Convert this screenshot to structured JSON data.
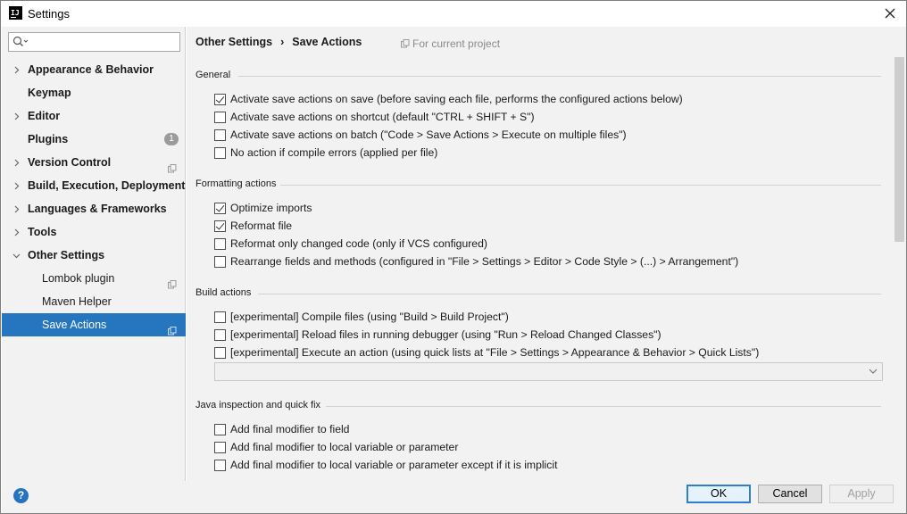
{
  "window": {
    "title": "Settings",
    "app_icon_text": "IJ"
  },
  "sidebar": {
    "search": {
      "value": "",
      "placeholder": ""
    },
    "items": [
      {
        "label": "Appearance & Behavior",
        "arrow": "right",
        "child": false
      },
      {
        "label": "Keymap",
        "arrow": "none",
        "child": false
      },
      {
        "label": "Editor",
        "arrow": "right",
        "child": false
      },
      {
        "label": "Plugins",
        "arrow": "none",
        "child": false,
        "badge": "1"
      },
      {
        "label": "Version Control",
        "arrow": "right",
        "child": false,
        "project_icon": true
      },
      {
        "label": "Build, Execution, Deployment",
        "arrow": "right",
        "child": false
      },
      {
        "label": "Languages & Frameworks",
        "arrow": "right",
        "child": false
      },
      {
        "label": "Tools",
        "arrow": "right",
        "child": false
      },
      {
        "label": "Other Settings",
        "arrow": "down",
        "child": false
      },
      {
        "label": "Lombok plugin",
        "arrow": "none",
        "child": true,
        "project_icon": true
      },
      {
        "label": "Maven Helper",
        "arrow": "none",
        "child": true
      },
      {
        "label": "Save Actions",
        "arrow": "none",
        "child": true,
        "project_icon": true,
        "selected": true
      }
    ]
  },
  "header": {
    "breadcrumb_parent": "Other Settings",
    "breadcrumb_sep": "›",
    "breadcrumb_current": "Save Actions",
    "for_project": "For current project"
  },
  "sections": {
    "general": {
      "title": "General",
      "options": [
        {
          "label": "Activate save actions on save (before saving each file, performs the configured actions below)",
          "checked": true
        },
        {
          "label": "Activate save actions on shortcut (default \"CTRL + SHIFT + S\")",
          "checked": false
        },
        {
          "label": "Activate save actions on batch (\"Code > Save Actions > Execute on multiple files\")",
          "checked": false
        },
        {
          "label": "No action if compile errors (applied per file)",
          "checked": false
        }
      ]
    },
    "formatting": {
      "title": "Formatting actions",
      "options": [
        {
          "label": "Optimize imports",
          "checked": true
        },
        {
          "label": "Reformat file",
          "checked": true
        },
        {
          "label": "Reformat only changed code (only if VCS configured)",
          "checked": false
        },
        {
          "label": "Rearrange fields and methods (configured in \"File > Settings > Editor > Code Style > (...) > Arrangement\")",
          "checked": false
        }
      ]
    },
    "build": {
      "title": "Build actions",
      "options": [
        {
          "label": "[experimental] Compile files (using \"Build > Build Project\")",
          "checked": false
        },
        {
          "label": "[experimental] Reload files in running debugger (using \"Run > Reload Changed Classes\")",
          "checked": false
        },
        {
          "label": "[experimental] Execute an action (using quick lists at \"File > Settings > Appearance & Behavior > Quick Lists\")",
          "checked": false
        }
      ],
      "quick_list_value": ""
    },
    "java": {
      "title": "Java inspection and quick fix",
      "options": [
        {
          "label": "Add final modifier to field",
          "checked": false
        },
        {
          "label": "Add final modifier to local variable or parameter",
          "checked": false
        },
        {
          "label": "Add final modifier to local variable or parameter except if it is implicit",
          "checked": false
        }
      ]
    }
  },
  "footer": {
    "help": "?",
    "ok": "OK",
    "cancel": "Cancel",
    "apply": "Apply"
  },
  "colors": {
    "selection": "#2675bf",
    "panel_bg": "#f2f2f2",
    "ok_border": "#2d7dd2",
    "help_blue": "#2473c2"
  }
}
